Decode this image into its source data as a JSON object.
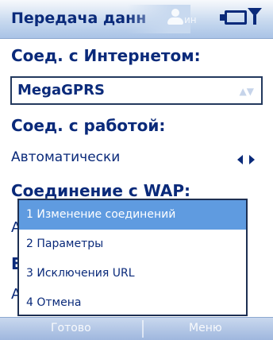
{
  "title_bar": {
    "title": "Передача данн",
    "faint_text": "ин"
  },
  "form": {
    "internet_label": "Соед. с Интернетом:",
    "internet_value": "MegaGPRS",
    "work_label": "Соед. с работой:",
    "work_value": "Автоматически",
    "wap_label": "Соединение с WAP:",
    "wap_value_partial": "А",
    "hidden_label_partial": "Е",
    "hidden_value_partial": "А"
  },
  "menu": {
    "items": [
      {
        "label": "1 Изменение соединений",
        "selected": true
      },
      {
        "label": "2 Параметры",
        "selected": false
      },
      {
        "label": "3 Исключения URL",
        "selected": false
      },
      {
        "label": "4 Отмена",
        "selected": false
      }
    ]
  },
  "softkeys": {
    "left": "Готово",
    "right": "Меню"
  },
  "colors": {
    "accent_text": "#0a2a7a",
    "menu_highlight": "#5f9be0",
    "titlebar": "#c8d9ef"
  }
}
